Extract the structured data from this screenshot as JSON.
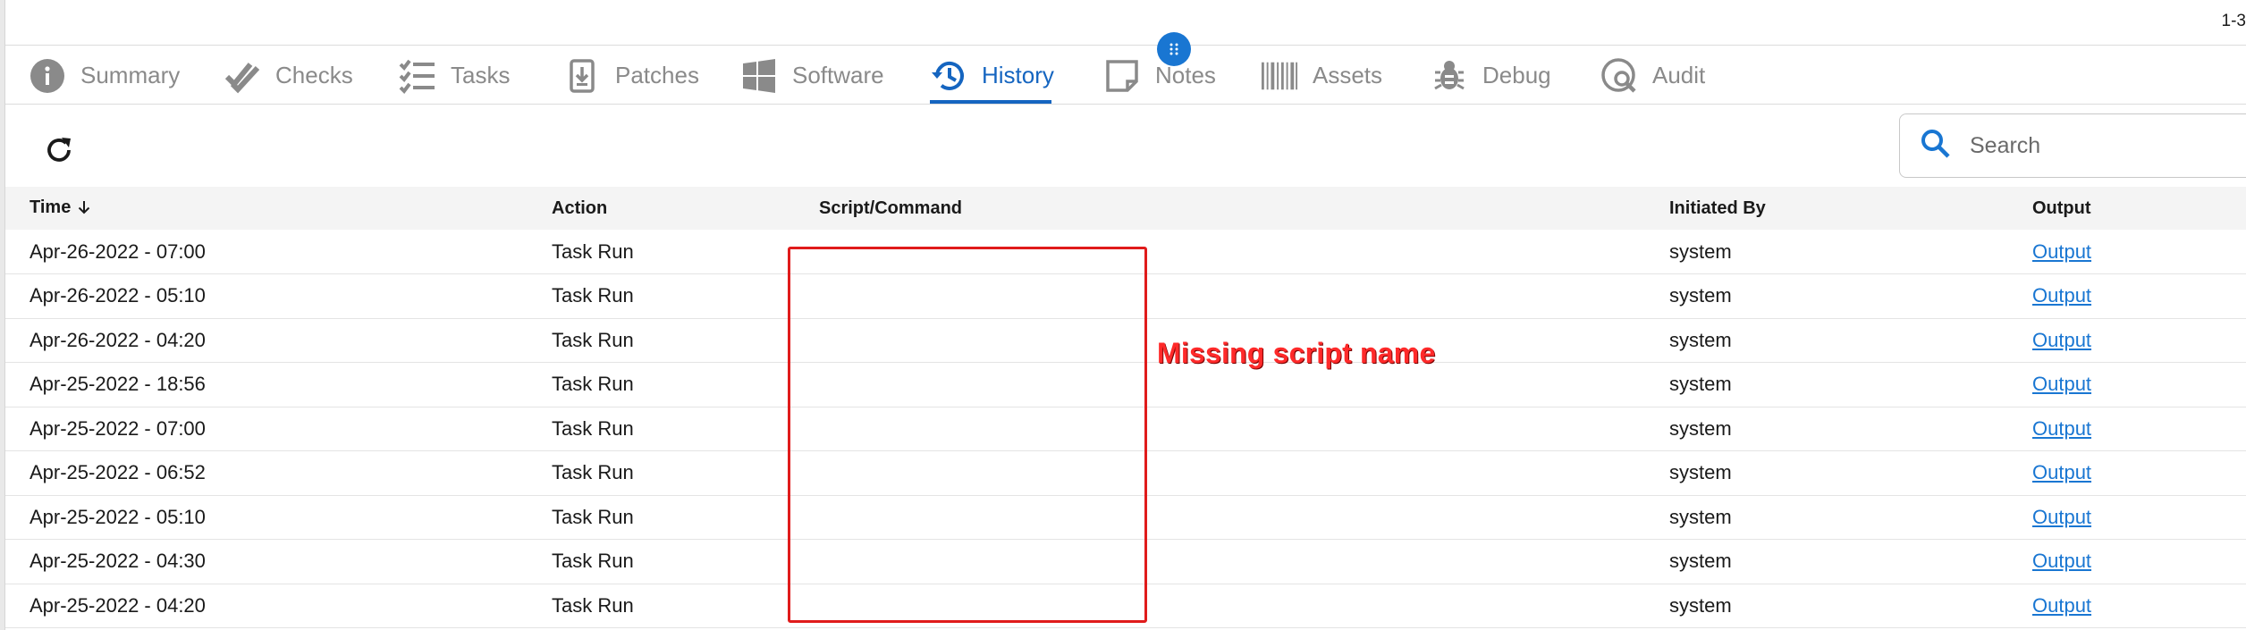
{
  "topbar": {
    "pager": "1-3"
  },
  "tabs": [
    {
      "label": "Summary",
      "icon": "info-icon"
    },
    {
      "label": "Checks",
      "icon": "double-check-icon"
    },
    {
      "label": "Tasks",
      "icon": "checklist-icon"
    },
    {
      "label": "Patches",
      "icon": "download-file-icon"
    },
    {
      "label": "Software",
      "icon": "windows-icon"
    },
    {
      "label": "History",
      "icon": "history-icon",
      "active": true
    },
    {
      "label": "Notes",
      "icon": "note-icon"
    },
    {
      "label": "Assets",
      "icon": "barcode-icon"
    },
    {
      "label": "Debug",
      "icon": "bug-icon"
    },
    {
      "label": "Audit",
      "icon": "audit-search-icon"
    }
  ],
  "colors": {
    "accent": "#1565c0",
    "link": "#1976d2",
    "annotation": "#e01b1b",
    "inactive_tab": "#8a8a8a"
  },
  "toolbar": {
    "search_placeholder": "Search"
  },
  "table": {
    "columns": {
      "time": "Time",
      "action": "Action",
      "script": "Script/Command",
      "initiated_by": "Initiated By",
      "output": "Output"
    },
    "sort": {
      "column": "Time",
      "direction": "descending"
    },
    "rows": [
      {
        "time": "Apr-26-2022 - 07:00",
        "action": "Task Run",
        "script": "",
        "initiated_by": "system",
        "output": "Output"
      },
      {
        "time": "Apr-26-2022 - 05:10",
        "action": "Task Run",
        "script": "",
        "initiated_by": "system",
        "output": "Output"
      },
      {
        "time": "Apr-26-2022 - 04:20",
        "action": "Task Run",
        "script": "",
        "initiated_by": "system",
        "output": "Output"
      },
      {
        "time": "Apr-25-2022 - 18:56",
        "action": "Task Run",
        "script": "",
        "initiated_by": "system",
        "output": "Output"
      },
      {
        "time": "Apr-25-2022 - 07:00",
        "action": "Task Run",
        "script": "",
        "initiated_by": "system",
        "output": "Output"
      },
      {
        "time": "Apr-25-2022 - 06:52",
        "action": "Task Run",
        "script": "",
        "initiated_by": "system",
        "output": "Output"
      },
      {
        "time": "Apr-25-2022 - 05:10",
        "action": "Task Run",
        "script": "",
        "initiated_by": "system",
        "output": "Output"
      },
      {
        "time": "Apr-25-2022 - 04:30",
        "action": "Task Run",
        "script": "",
        "initiated_by": "system",
        "output": "Output"
      },
      {
        "time": "Apr-25-2022 - 04:20",
        "action": "Task Run",
        "script": "",
        "initiated_by": "system",
        "output": "Output"
      }
    ]
  },
  "annotation": {
    "label": "Missing script name"
  }
}
